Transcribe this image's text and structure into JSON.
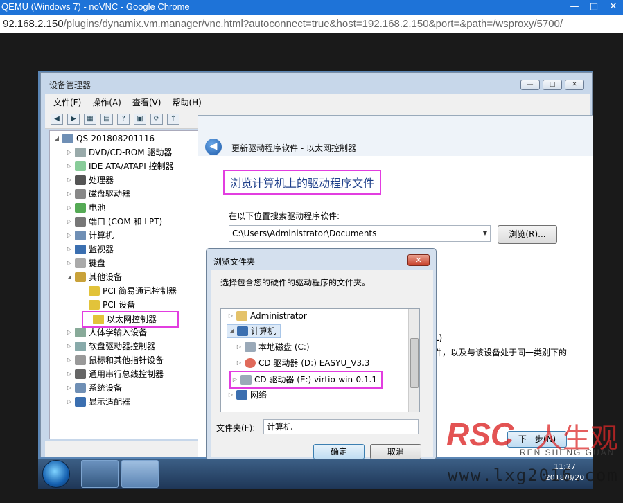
{
  "browser": {
    "title": "QEMU (Windows 7) - noVNC - Google Chrome",
    "url_host": "92.168.2.150",
    "url_path": "/plugins/dynamix.vm.manager/vnc.html?autoconnect=true&host=192.168.2.150&port=&path=/wsproxy/5700/",
    "controls": [
      "—",
      "□",
      "✕"
    ]
  },
  "device_manager": {
    "title": "设备管理器",
    "menu": [
      "文件(F)",
      "操作(A)",
      "查看(V)",
      "帮助(H)"
    ],
    "tree": [
      {
        "label": "QS-201808201116",
        "level": 0,
        "expanded": true
      },
      {
        "label": "DVD/CD-ROM 驱动器",
        "level": 1
      },
      {
        "label": "IDE ATA/ATAPI 控制器",
        "level": 1
      },
      {
        "label": "处理器",
        "level": 1
      },
      {
        "label": "磁盘驱动器",
        "level": 1
      },
      {
        "label": "电池",
        "level": 1
      },
      {
        "label": "端口 (COM 和 LPT)",
        "level": 1
      },
      {
        "label": "计算机",
        "level": 1
      },
      {
        "label": "监视器",
        "level": 1
      },
      {
        "label": "键盘",
        "level": 1
      },
      {
        "label": "其他设备",
        "level": 1,
        "expanded": true
      },
      {
        "label": "PCI 简易通讯控制器",
        "level": 2
      },
      {
        "label": "PCI 设备",
        "level": 2
      },
      {
        "label": "以太网控制器",
        "level": 2,
        "highlighted": true
      },
      {
        "label": "人体学输入设备",
        "level": 1
      },
      {
        "label": "软盘驱动器控制器",
        "level": 1
      },
      {
        "label": "鼠标和其他指针设备",
        "level": 1
      },
      {
        "label": "通用串行总线控制器",
        "level": 1
      },
      {
        "label": "系统设备",
        "level": 1
      },
      {
        "label": "显示适配器",
        "level": 1
      }
    ]
  },
  "update_driver": {
    "title": "更新驱动程序软件 - 以太网控制器",
    "heading": "浏览计算机上的驱动程序文件",
    "search_label": "在以下位置搜索驱动程序软件:",
    "path_value": "C:\\Users\\Administrator\\Documents",
    "browse_button": "浏览(R)...",
    "partial_text_1": "L)",
    "partial_text_2": "件，以及与该设备处于同一类别下的",
    "next_button": "下一步(N)"
  },
  "browse_folder": {
    "title": "浏览文件夹",
    "close": "✕",
    "description": "选择包含您的硬件的驱动程序的文件夹。",
    "tree": [
      {
        "label": "Administrator",
        "level": 0
      },
      {
        "label": "计算机",
        "level": 0,
        "expanded": true,
        "selected": true
      },
      {
        "label": "本地磁盘 (C:)",
        "level": 1
      },
      {
        "label": "CD 驱动器 (D:) EASYU_V3.3",
        "level": 1
      },
      {
        "label": "CD 驱动器 (E:) virtio-win-0.1.1",
        "level": 1,
        "highlighted": true
      },
      {
        "label": "网络",
        "level": 0
      }
    ],
    "folder_label": "文件夹(F):",
    "folder_value": "计算机",
    "ok_button": "确定",
    "cancel_button": "取消"
  },
  "taskbar": {
    "time": "11:27",
    "date": "2018/8/20"
  },
  "watermark": {
    "brand": "RSC",
    "brand_cn": "人生观",
    "sub": "REN SHENG GUAN",
    "url": "www.lxg2016.com"
  },
  "colors": {
    "highlight": "#e23de0",
    "chrome_blue": "#1e73d8",
    "heading_blue": "#1e3f8a"
  }
}
